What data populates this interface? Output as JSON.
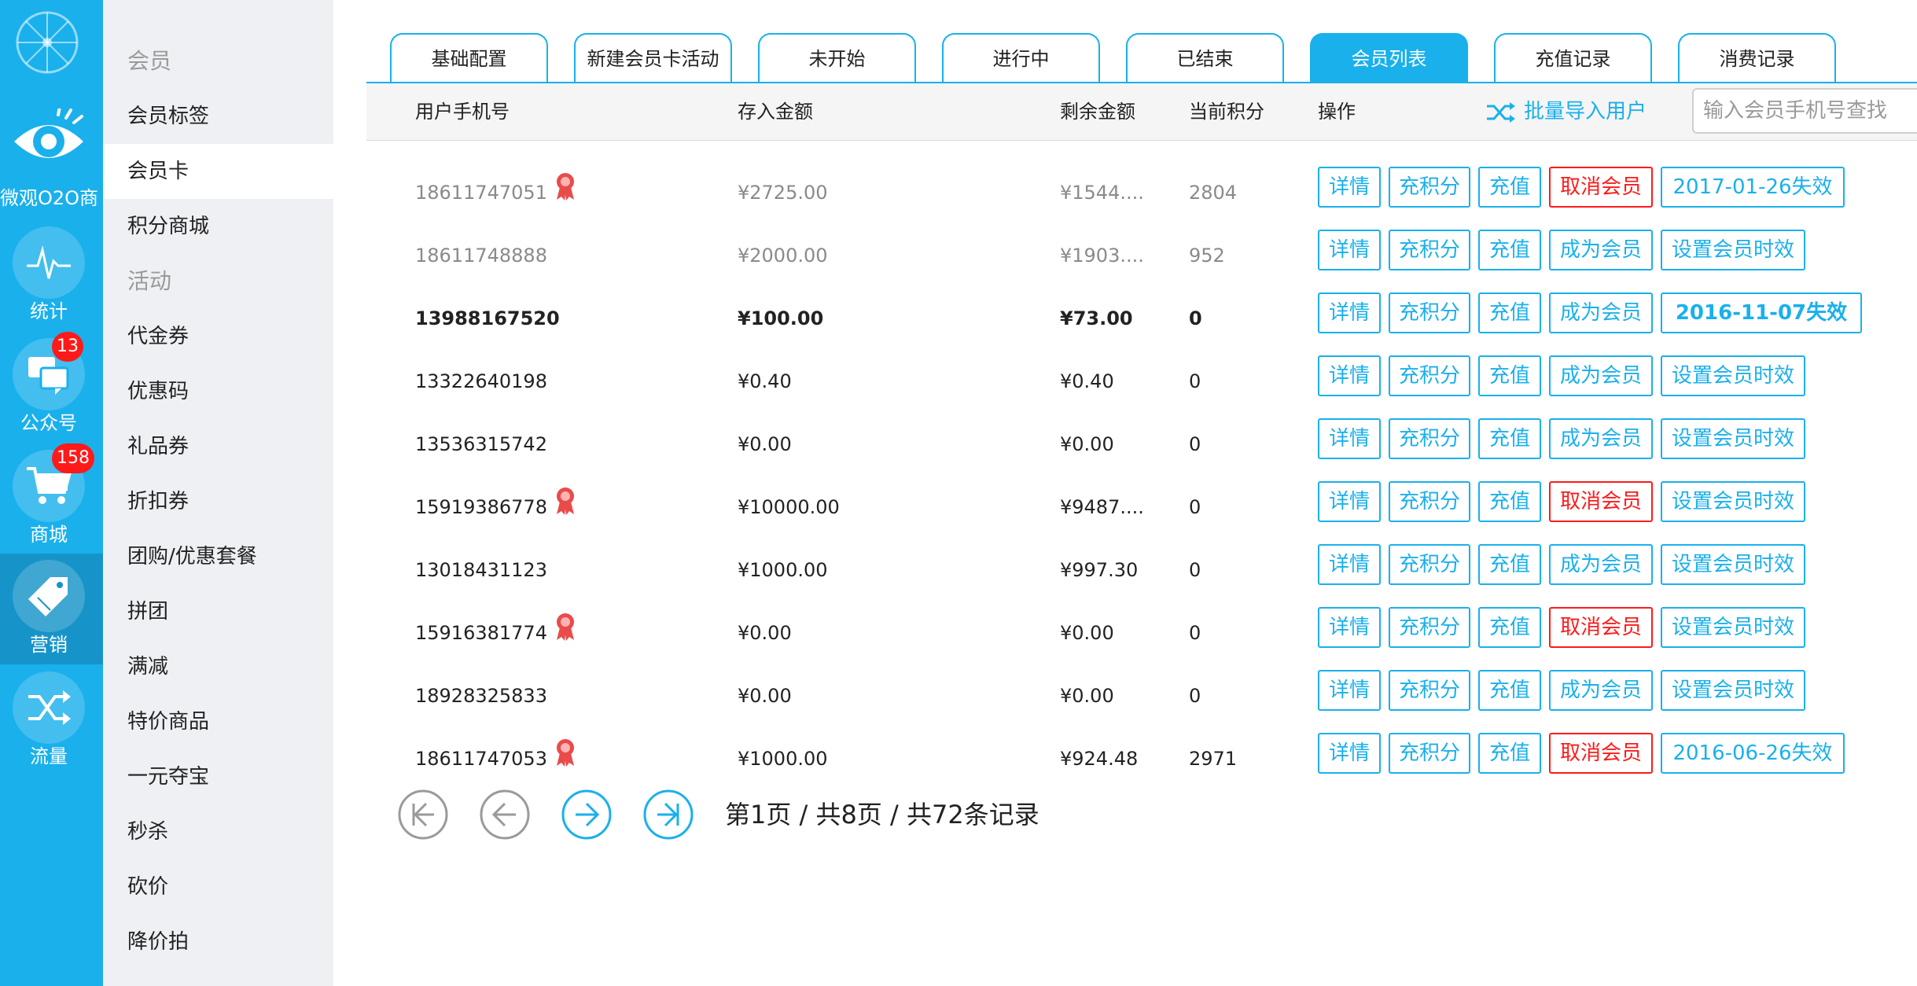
{
  "rail": {
    "brand": "微观O2O商...",
    "items": [
      {
        "label": "统计",
        "icon": "pulse-icon",
        "badge": ""
      },
      {
        "label": "公众号",
        "icon": "chat-icon",
        "badge": "13"
      },
      {
        "label": "商城",
        "icon": "cart-icon",
        "badge": "158"
      },
      {
        "label": "营销",
        "icon": "tag-icon",
        "badge": ""
      },
      {
        "label": "流量",
        "icon": "shuffle-icon",
        "badge": ""
      }
    ],
    "active": "营销"
  },
  "submenu": {
    "items": [
      {
        "label": "会员",
        "type": "header"
      },
      {
        "label": "会员标签",
        "type": "link"
      },
      {
        "label": "会员卡",
        "type": "active"
      },
      {
        "label": "积分商城",
        "type": "link"
      },
      {
        "label": "活动",
        "type": "header"
      },
      {
        "label": "代金券",
        "type": "link"
      },
      {
        "label": "优惠码",
        "type": "link"
      },
      {
        "label": "礼品券",
        "type": "link"
      },
      {
        "label": "折扣券",
        "type": "link"
      },
      {
        "label": "团购/优惠套餐",
        "type": "link"
      },
      {
        "label": "拼团",
        "type": "link"
      },
      {
        "label": "满减",
        "type": "link"
      },
      {
        "label": "特价商品",
        "type": "link"
      },
      {
        "label": "一元夺宝",
        "type": "link"
      },
      {
        "label": "秒杀",
        "type": "link"
      },
      {
        "label": "砍价",
        "type": "link"
      },
      {
        "label": "降价拍",
        "type": "link"
      }
    ]
  },
  "tabs": [
    {
      "label": "基础配置",
      "active": false
    },
    {
      "label": "新建会员卡活动",
      "active": false
    },
    {
      "label": "未开始",
      "active": false
    },
    {
      "label": "进行中",
      "active": false
    },
    {
      "label": "已结束",
      "active": false
    },
    {
      "label": "会员列表",
      "active": true
    },
    {
      "label": "充值记录",
      "active": false
    },
    {
      "label": "消费记录",
      "active": false
    }
  ],
  "table": {
    "columns": {
      "phone": "用户手机号",
      "deposit": "存入金额",
      "balance": "剩余金额",
      "points": "当前积分",
      "actions": "操作"
    },
    "batch_import": "批量导入用户",
    "search_placeholder": "输入会员手机号查找",
    "buttons": {
      "detail": "详情",
      "add_points": "充积分",
      "recharge": "充值",
      "cancel_member": "取消会员",
      "become_member": "成为会员",
      "set_expiry": "设置会员时效"
    },
    "rows": [
      {
        "phone": "18611747051",
        "medal": true,
        "deposit": "¥2725.00",
        "balance": "¥1544....",
        "points": "2804",
        "member": true,
        "expiry": "2017-01-26失效",
        "style": "gray"
      },
      {
        "phone": "18611748888",
        "medal": false,
        "deposit": "¥2000.00",
        "balance": "¥1903....",
        "points": "952",
        "member": false,
        "expiry": "设置会员时效",
        "style": "gray"
      },
      {
        "phone": "13988167520",
        "medal": false,
        "deposit": "¥100.00",
        "balance": "¥73.00",
        "points": "0",
        "member": false,
        "expiry": "2016-11-07失效",
        "style": "bold"
      },
      {
        "phone": "13322640198",
        "medal": false,
        "deposit": "¥0.40",
        "balance": "¥0.40",
        "points": "0",
        "member": false,
        "expiry": "设置会员时效",
        "style": "normal"
      },
      {
        "phone": "13536315742",
        "medal": false,
        "deposit": "¥0.00",
        "balance": "¥0.00",
        "points": "0",
        "member": false,
        "expiry": "设置会员时效",
        "style": "normal"
      },
      {
        "phone": "15919386778",
        "medal": true,
        "deposit": "¥10000.00",
        "balance": "¥9487....",
        "points": "0",
        "member": true,
        "expiry": "设置会员时效",
        "style": "normal"
      },
      {
        "phone": "13018431123",
        "medal": false,
        "deposit": "¥1000.00",
        "balance": "¥997.30",
        "points": "0",
        "member": false,
        "expiry": "设置会员时效",
        "style": "normal"
      },
      {
        "phone": "15916381774",
        "medal": true,
        "deposit": "¥0.00",
        "balance": "¥0.00",
        "points": "0",
        "member": true,
        "expiry": "设置会员时效",
        "style": "normal"
      },
      {
        "phone": "18928325833",
        "medal": false,
        "deposit": "¥0.00",
        "balance": "¥0.00",
        "points": "0",
        "member": false,
        "expiry": "设置会员时效",
        "style": "normal"
      },
      {
        "phone": "18611747053",
        "medal": true,
        "deposit": "¥1000.00",
        "balance": "¥924.48",
        "points": "2971",
        "member": true,
        "expiry": "2016-06-26失效",
        "style": "normal"
      }
    ]
  },
  "pager": {
    "text": "第1页 / 共8页 / 共72条记录",
    "first_disabled": true,
    "prev_disabled": true
  },
  "colors": {
    "accent": "#1ab0ec",
    "rail_active": "#1694c9",
    "danger": "#ff1a1a",
    "disabled": "#9a9a9a",
    "medal": "#e94b4b"
  }
}
